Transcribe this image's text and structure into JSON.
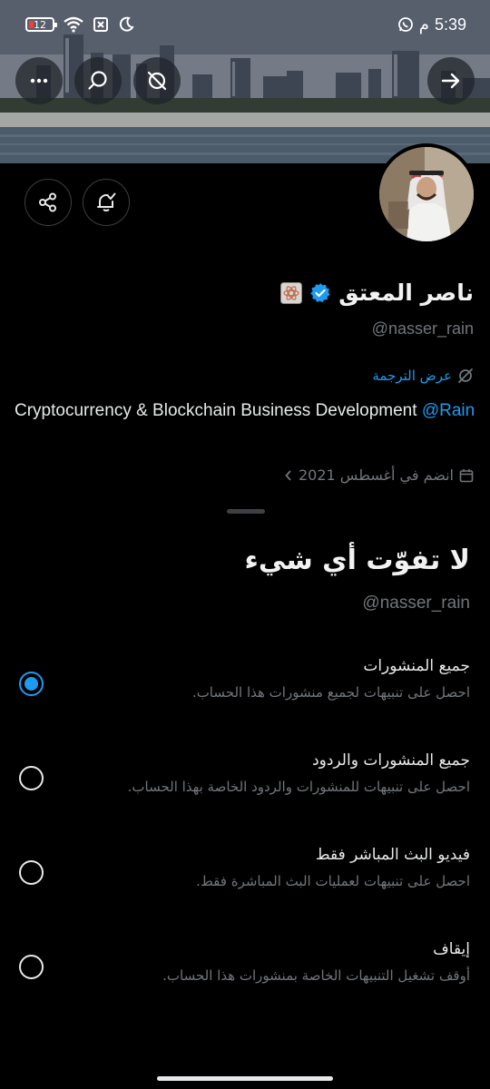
{
  "status_bar": {
    "battery": "12",
    "time": "5:39",
    "time_suffix": "م"
  },
  "profile": {
    "display_name": "ناصر المعتق",
    "handle": "@nasser_rain",
    "translate_label": "عرض الترجمة",
    "bio_text": "Cryptocurrency & Blockchain Business Development ",
    "bio_mention": "@Rain",
    "joined": "انضم في أغسطس 2021"
  },
  "sheet": {
    "title": "لا تفوّت أي شيء",
    "handle": "@nasser_rain",
    "options": [
      {
        "label": "جميع المنشورات",
        "description": "احصل على تنبيهات لجميع منشورات هذا الحساب.",
        "selected": true
      },
      {
        "label": "جميع المنشورات والردود",
        "description": "احصل على تنبيهات للمنشورات والردود الخاصة بهذا الحساب.",
        "selected": false
      },
      {
        "label": "فيديو البث المباشر فقط",
        "description": "احصل على تنبيهات لعمليات البث المباشرة فقط.",
        "selected": false
      },
      {
        "label": "إيقاف",
        "description": "أوقف تشغيل التنبيهات الخاصة بمنشورات هذا الحساب.",
        "selected": false
      }
    ]
  },
  "colors": {
    "accent": "#1d9bf0",
    "muted": "#71767b",
    "background": "#000000"
  }
}
